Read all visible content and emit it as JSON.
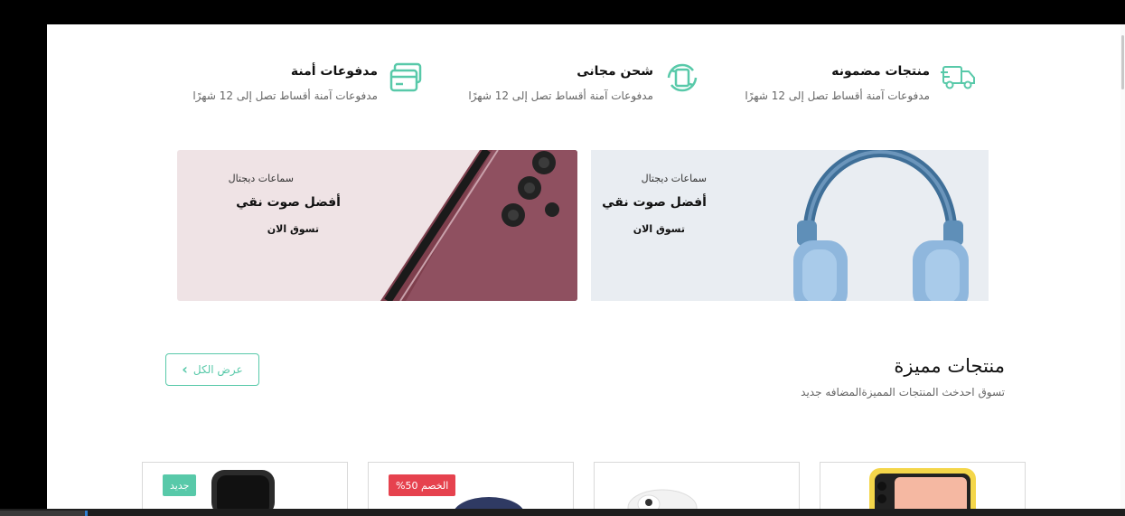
{
  "features": [
    {
      "title": "منتجات مضمونه",
      "desc": "مدفوعات آمنة أقساط تصل إلى 12 شهرًا",
      "icon": "truck-icon"
    },
    {
      "title": "شحن مجانى",
      "desc": "مدفوعات آمنة أقساط تصل إلى 12 شهرًا",
      "icon": "refresh-icon"
    },
    {
      "title": "مدفوعات أمنة",
      "desc": "مدفوعات آمنة أقساط تصل إلى 12 شهرًا",
      "icon": "credit-card-icon"
    }
  ],
  "banners": [
    {
      "category": "سماعات ديجتال",
      "heading": "أفضل صوت نقي",
      "cta": "تسوق الان",
      "image": "headphones"
    },
    {
      "category": "سماعات ديجتال",
      "heading": "أفضل صوت نقي",
      "cta": "تسوق الان",
      "image": "smartphone"
    }
  ],
  "featured": {
    "title": "منتجات مميزة",
    "subtitle": "تسوق احدخث المنتجات المميزةالمضافه جديد",
    "view_all": "عرض الكل"
  },
  "products": [
    {
      "image": "phone-yellow",
      "badge": ""
    },
    {
      "image": "earbuds",
      "badge": ""
    },
    {
      "image": "headphones-navy",
      "badge": "الخصم 50%"
    },
    {
      "image": "smartwatch",
      "badge": "جديد"
    }
  ],
  "colors": {
    "accent": "#58c9a9",
    "sale": "#e6424e"
  }
}
